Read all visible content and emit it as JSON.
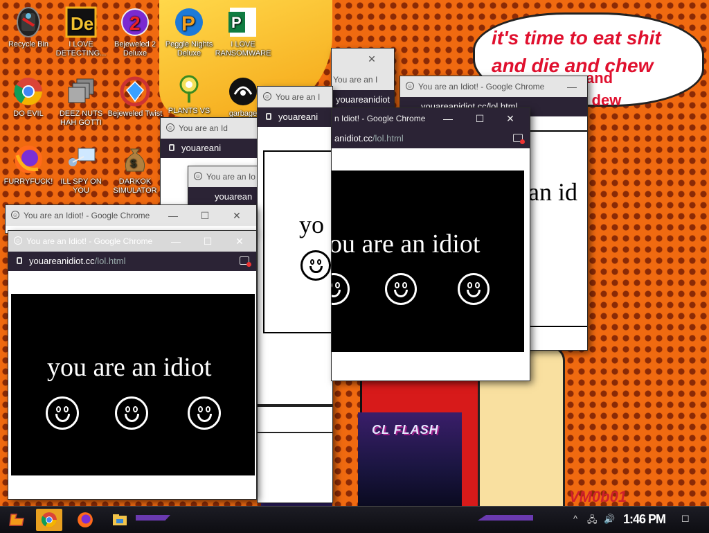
{
  "desktop": {
    "icons": [
      {
        "label": "Recycle Bin",
        "icon": "recycle-bin-icon"
      },
      {
        "label": "I LOVE DETECTING...",
        "icon": "detecting-app-icon"
      },
      {
        "label": "Bejeweled 2 Deluxe",
        "icon": "bejeweled-2-icon"
      },
      {
        "label": "Peggle Nights Deluxe",
        "icon": "peggle-icon"
      },
      {
        "label": "I LOVE RANSOMWARE",
        "icon": "ransomware-publisher-icon"
      },
      {
        "label": "DO EVIL",
        "icon": "chrome-icon"
      },
      {
        "label": "DEEZ NUTS HAH GOTTI",
        "icon": "stacked-windows-icon"
      },
      {
        "label": "Bejeweled Twist",
        "icon": "bejeweled-twist-icon"
      },
      {
        "label": "PLANTS VS",
        "icon": "plants-vs-zombies-icon"
      },
      {
        "label": "garbage",
        "icon": "garbage-icon"
      },
      {
        "label": "FURRYFUCK!",
        "icon": "firefox-icon"
      },
      {
        "label": "ILL SPY ON YOU",
        "icon": "network-spy-icon"
      },
      {
        "label": "DARKOK SIMULATOR",
        "icon": "money-bag-icon"
      }
    ]
  },
  "wallpaper": {
    "speech": "it's time to eat shit and die and chew",
    "speech_extra_1": "and",
    "speech_extra_2": "n dew",
    "poster_title": "CL FLASH",
    "watermark": "VM0b01"
  },
  "windows": {
    "title": "You are an Idiot! - Google Chrome",
    "title_short": "You are an I",
    "title_short2": "You are an Io",
    "title_partial": "You are an Id",
    "title_partial2": "n Idiot! - Google Chrome",
    "url_host": "youareanidiot.cc",
    "url_path": "/lol.html",
    "url_host_short": "youareani",
    "url_host_short2": "youareanidiot",
    "url_host_short3": "youarean",
    "url_partial_host": "anidiot.cc",
    "url_partial2": "youareanidiot.cc/lol.html",
    "message": "you are an idiot",
    "message_partial1": "yo",
    "message_partial2": "an id",
    "message_partial3": "ou are an idiot",
    "minimize": "—",
    "maximize": "☐",
    "close": "✕"
  },
  "taskbar": {
    "time": "1:46 PM"
  }
}
